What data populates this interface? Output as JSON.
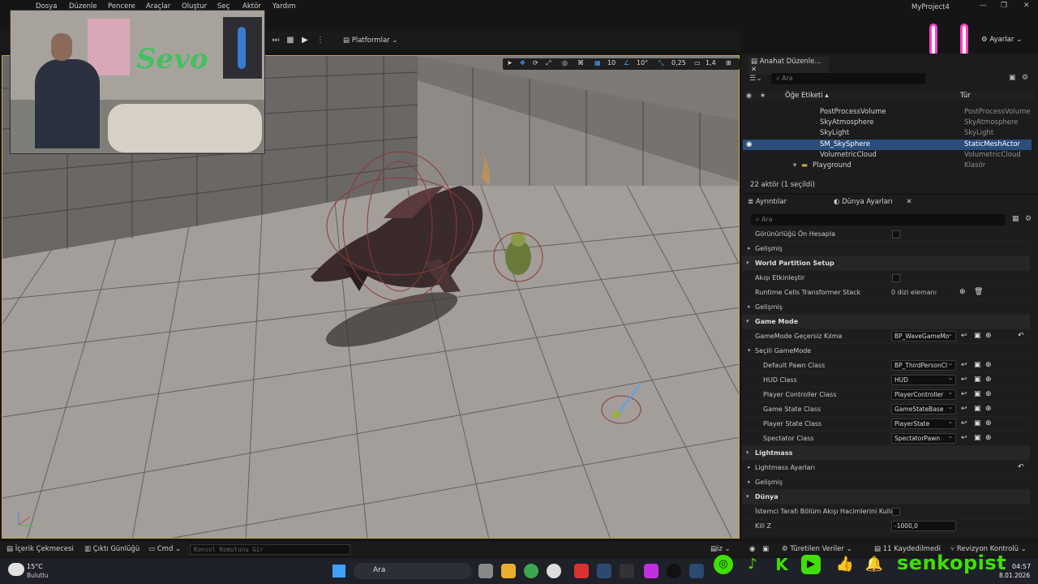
{
  "menu": {
    "items": [
      "Dosya",
      "Düzenle",
      "Pencere",
      "Araçlar",
      "Oluştur",
      "Seç",
      "Aktör",
      "Yardım"
    ],
    "project": "MyProject4"
  },
  "toolbar": {
    "platforms": "Platformlar",
    "settings": "Ayarlar"
  },
  "viewport_tools": {
    "grid": "10",
    "rotation": "10°",
    "scale": "0,25",
    "camera": "1,4"
  },
  "outliner": {
    "tab": "Anahat Düzenle...",
    "search_placeholder": "Ara",
    "col_label": "Öğe Etiketi",
    "col_type": "Tür",
    "rows": [
      {
        "name": "PostProcessVolume",
        "type": "PostProcessVolume"
      },
      {
        "name": "SkyAtmosphere",
        "type": "SkyAtmosphere"
      },
      {
        "name": "SkyLight",
        "type": "SkyLight"
      },
      {
        "name": "SM_SkySphere",
        "type": "StaticMeshActor",
        "selected": true
      },
      {
        "name": "VolumetricCloud",
        "type": "VolumetricCloud"
      },
      {
        "name": "Playground",
        "type": "Klasör"
      }
    ],
    "count": "22 aktör (1 seçildi)"
  },
  "details": {
    "tab_details": "Ayrıntılar",
    "tab_world": "Dünya Ayarları",
    "search_placeholder": "Ara",
    "rows": [
      {
        "kind": "prop",
        "label": "Görünürlüğü Ön Hesapla",
        "indent": 1,
        "control": "check"
      },
      {
        "kind": "sub",
        "label": "Gelişmiş",
        "indent": 1
      },
      {
        "kind": "cat",
        "label": "World Partition Setup"
      },
      {
        "kind": "prop",
        "label": "Akışı Etkinleştir",
        "indent": 1,
        "control": "check"
      },
      {
        "kind": "prop",
        "label": "Runtime Cells Transformer Stack",
        "indent": 1,
        "control": "array",
        "value": "0 dizi elemanı"
      },
      {
        "kind": "sub",
        "label": "Gelişmiş",
        "indent": 1
      },
      {
        "kind": "cat",
        "label": "Game Mode"
      },
      {
        "kind": "prop",
        "label": "GameMode Geçersiz Kılma",
        "indent": 1,
        "control": "combo",
        "value": "BP_WaveGameMo"
      },
      {
        "kind": "sub",
        "label": "Seçili GameMode",
        "indent": 1,
        "open": true
      },
      {
        "kind": "prop",
        "label": "Default Pawn Class",
        "indent": 2,
        "control": "combo",
        "value": "BP_ThirdPersonCl"
      },
      {
        "kind": "prop",
        "label": "HUD Class",
        "indent": 2,
        "control": "combo",
        "value": "HUD"
      },
      {
        "kind": "prop",
        "label": "Player Controller Class",
        "indent": 2,
        "control": "combo",
        "value": "PlayerController"
      },
      {
        "kind": "prop",
        "label": "Game State Class",
        "indent": 2,
        "control": "combo",
        "value": "GameStateBase"
      },
      {
        "kind": "prop",
        "label": "Player State Class",
        "indent": 2,
        "control": "combo",
        "value": "PlayerState"
      },
      {
        "kind": "prop",
        "label": "Spectator Class",
        "indent": 2,
        "control": "combo",
        "value": "SpectatorPawn"
      },
      {
        "kind": "cat",
        "label": "Lightmass"
      },
      {
        "kind": "sub",
        "label": "Lightmass Ayarları",
        "indent": 1
      },
      {
        "kind": "sub",
        "label": "Gelişmiş",
        "indent": 1
      },
      {
        "kind": "cat",
        "label": "Dünya"
      },
      {
        "kind": "prop",
        "label": "İstemci Tarafı Bölüm Akışı Hacimlerini Kullan",
        "indent": 1,
        "control": "check"
      },
      {
        "kind": "prop",
        "label": "Kill Z",
        "indent": 1,
        "control": "number",
        "value": "-1000,0"
      }
    ]
  },
  "bottombar": {
    "content": "İçerik Çekmecesi",
    "output": "Çıktı Günlüğü",
    "cmd": "Cmd",
    "console_placeholder": "Konsol Komutunu Gir",
    "derived": "Türetilen Veriler",
    "saved": "11 Kaydedilmedi",
    "revision": "Revizyon Kontrolü"
  },
  "taskbar": {
    "temp": "15°C",
    "weather": "Bulutlu",
    "search": "Ara",
    "time": "04:57",
    "date": "8.01.2026"
  },
  "overlay": {
    "name": "senkopist",
    "wall_text": "Sevo"
  },
  "colors": {
    "accent": "#caa34a",
    "select": "#2a4d7a",
    "green": "#3fe000",
    "pink": "#ff3fc8"
  }
}
